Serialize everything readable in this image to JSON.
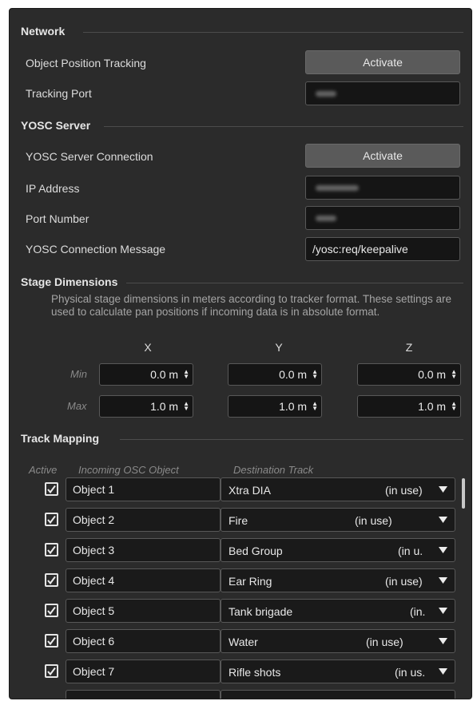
{
  "network": {
    "title": "Network",
    "object_tracking_label": "Object Position Tracking",
    "object_tracking_button": "Activate",
    "tracking_port_label": "Tracking Port"
  },
  "yosc": {
    "title": "YOSC Server",
    "connection_label": "YOSC Server Connection",
    "connection_button": "Activate",
    "ip_label": "IP Address",
    "port_label": "Port Number",
    "message_label": "YOSC Connection Message",
    "message_value": "/yosc:req/keepalive"
  },
  "stage": {
    "title": "Stage Dimensions",
    "description": "Physical stage dimensions in meters according to tracker format. These settings are used to calculate pan positions if incoming data is in absolute format.",
    "axis_x": "X",
    "axis_y": "Y",
    "axis_z": "Z",
    "min_label": "Min",
    "max_label": "Max",
    "min": {
      "x": "0.0 m",
      "y": "0.0 m",
      "z": "0.0 m"
    },
    "max": {
      "x": "1.0 m",
      "y": "1.0 m",
      "z": "1.0 m"
    }
  },
  "mapping": {
    "title": "Track Mapping",
    "col_active": "Active",
    "col_incoming": "Incoming OSC Object",
    "col_destination": "Destination Track",
    "rows": [
      {
        "object": "Object 1",
        "track": "Xtra DIA",
        "status": "(in use)"
      },
      {
        "object": "Object 2",
        "track": "Fire",
        "status": "(in use)"
      },
      {
        "object": "Object 3",
        "track": "Bed Group",
        "status": "(in u."
      },
      {
        "object": "Object 4",
        "track": "Ear Ring",
        "status": "(in use)"
      },
      {
        "object": "Object 5",
        "track": "Tank brigade",
        "status": "(in."
      },
      {
        "object": "Object 6",
        "track": "Water",
        "status": "(in use)"
      },
      {
        "object": "Object 7",
        "track": "Rifle shots",
        "status": "(in us."
      }
    ]
  },
  "icons": {
    "checkbox": "checkmark-icon",
    "dropdown": "caret-down-icon",
    "stepper": "up-down-arrows-icon"
  },
  "colors": {
    "panel_bg": "#2b2b2b",
    "field_bg": "#151515",
    "button_bg": "#5a5a5a",
    "text": "#dcdcdc",
    "muted": "#8a8a8a"
  }
}
